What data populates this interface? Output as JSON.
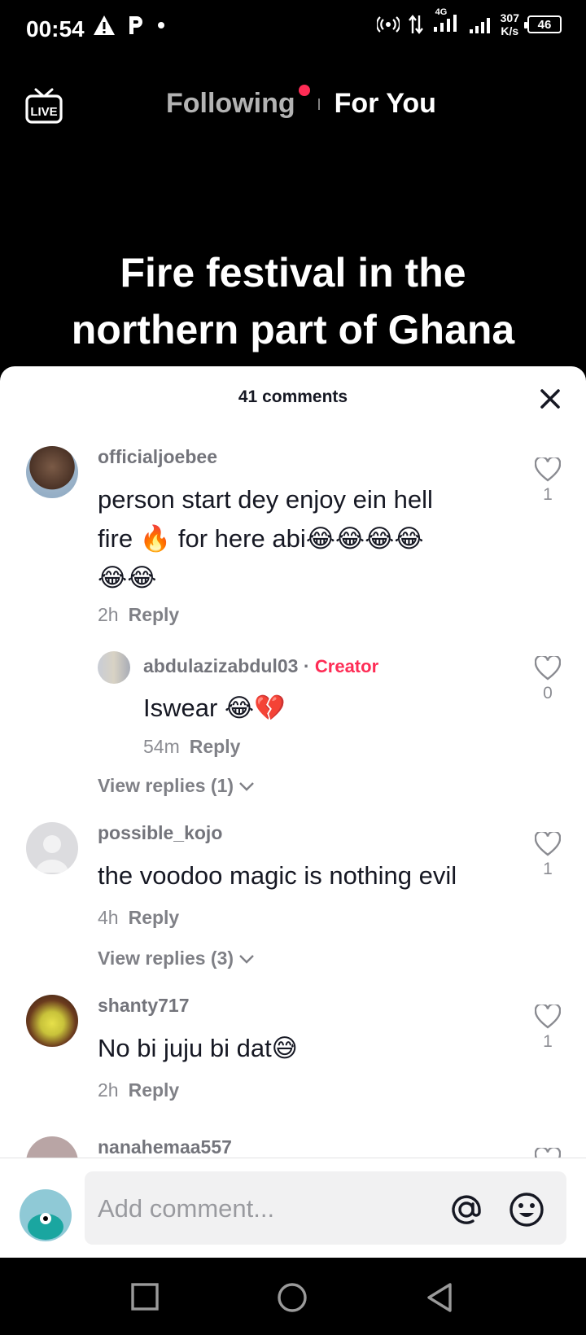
{
  "status_bar": {
    "time": "00:54",
    "network": "4G",
    "speed_value": "307",
    "speed_unit": "K/s",
    "battery": "46"
  },
  "top_nav": {
    "live_label": "LIVE",
    "tab_following": "Following",
    "tab_for_you": "For You"
  },
  "video": {
    "caption_line1": "Fire festival in the",
    "caption_line2": "northern part of Ghana"
  },
  "comments_sheet": {
    "title": "41 comments",
    "comments": [
      {
        "username": "officialjoebee",
        "text_line1": "person start dey enjoy ein hell",
        "text_line2": "fire 🔥 for here abi😂😂😂😂",
        "text_line3": "😂😂",
        "time": "2h",
        "reply_label": "Reply",
        "likes": "1"
      },
      {
        "username": "abdulazizabdul03",
        "separator": "·",
        "badge": "Creator",
        "text": "Iswear 😂💔",
        "time": "54m",
        "reply_label": "Reply",
        "likes": "0"
      },
      {
        "username": "possible_kojo",
        "text": "the voodoo magic is nothing evil",
        "time": "4h",
        "reply_label": "Reply",
        "likes": "1"
      },
      {
        "username": "shanty717",
        "text": "No bi juju bi dat😅",
        "time": "2h",
        "reply_label": "Reply",
        "likes": "1"
      },
      {
        "username": "nanahemaa557"
      }
    ],
    "view_replies_1": "View replies (1)",
    "view_replies_2": "View replies (3)"
  },
  "input": {
    "placeholder": "Add comment..."
  },
  "colors": {
    "accent": "#fe2c55",
    "text_primary": "#161823"
  }
}
